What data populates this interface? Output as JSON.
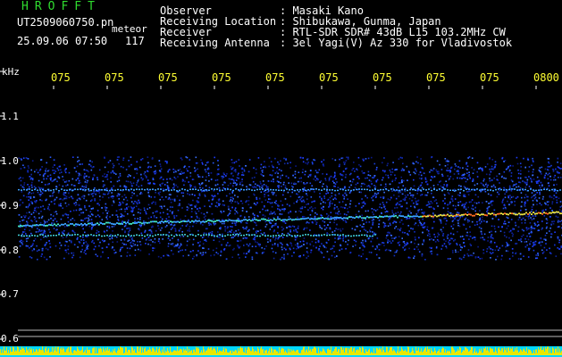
{
  "header": {
    "app_title": "HROFFT",
    "filename": "UT2509060750.pn",
    "mode": "meteor",
    "datetime": "25.09.06 07:50",
    "count": "117"
  },
  "info": [
    {
      "key": "Observer",
      "value": ": Masaki Kano"
    },
    {
      "key": "Receiving Location",
      "value": ": Shibukawa, Gunma, Japan"
    },
    {
      "key": "Receiver",
      "value": ": RTL-SDR SDR# 43dB L15 103.2MHz CW"
    },
    {
      "key": "Receiving Antenna",
      "value": ": 3el Yagi(V) Az 330 for Vladivostok"
    }
  ],
  "axis": {
    "unit": "kHz",
    "y_ticks": [
      "1.1",
      "1.0",
      "0.9",
      "0.8",
      "0.7",
      "0.6"
    ],
    "x_ticks": [
      "075",
      "075",
      "075",
      "075",
      "075",
      "075",
      "075",
      "075",
      "075",
      "0800"
    ]
  },
  "colors": {
    "background": "#000000",
    "title_green": "#2fdc2f",
    "tick_yellow": "#ffff33",
    "signal_blue": "#1e3cff",
    "baseline_cyan": "#00d8ff"
  }
}
